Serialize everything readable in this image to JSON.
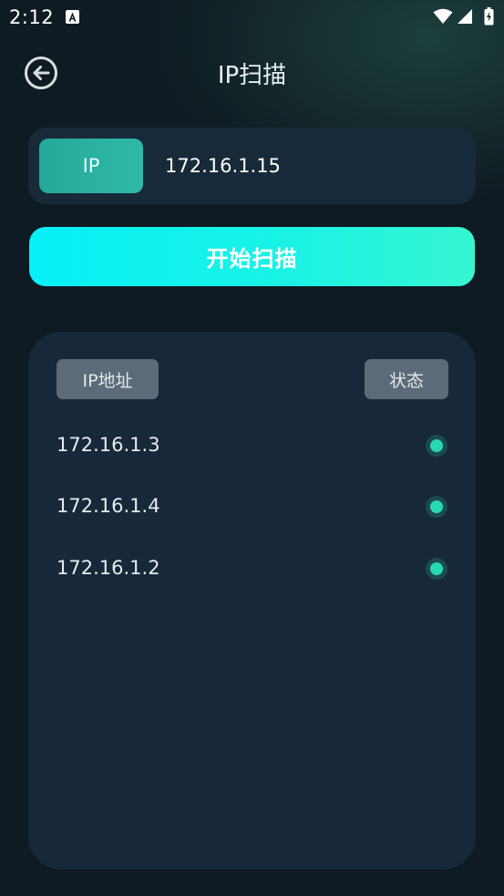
{
  "status_bar": {
    "time": "2:12"
  },
  "header": {
    "title": "IP扫描",
    "back_icon": "back-arrow-circle-icon"
  },
  "ip_form": {
    "label": "IP",
    "value": "172.16.1.15"
  },
  "scan_button": {
    "label": "开始扫描"
  },
  "results": {
    "columns": [
      "IP地址",
      "状态"
    ],
    "rows": [
      {
        "ip": "172.16.1.3",
        "status": "online"
      },
      {
        "ip": "172.16.1.4",
        "status": "online"
      },
      {
        "ip": "172.16.1.2",
        "status": "online"
      }
    ]
  },
  "colors": {
    "background": "#0f1b22",
    "card": "#172a39",
    "accent_teal": "#2bb3a1",
    "scan_gradient_start": "#06f0f6",
    "scan_gradient_end": "#36f6d2",
    "chip": "#5d6b78",
    "status_online": "#27d9b2"
  }
}
